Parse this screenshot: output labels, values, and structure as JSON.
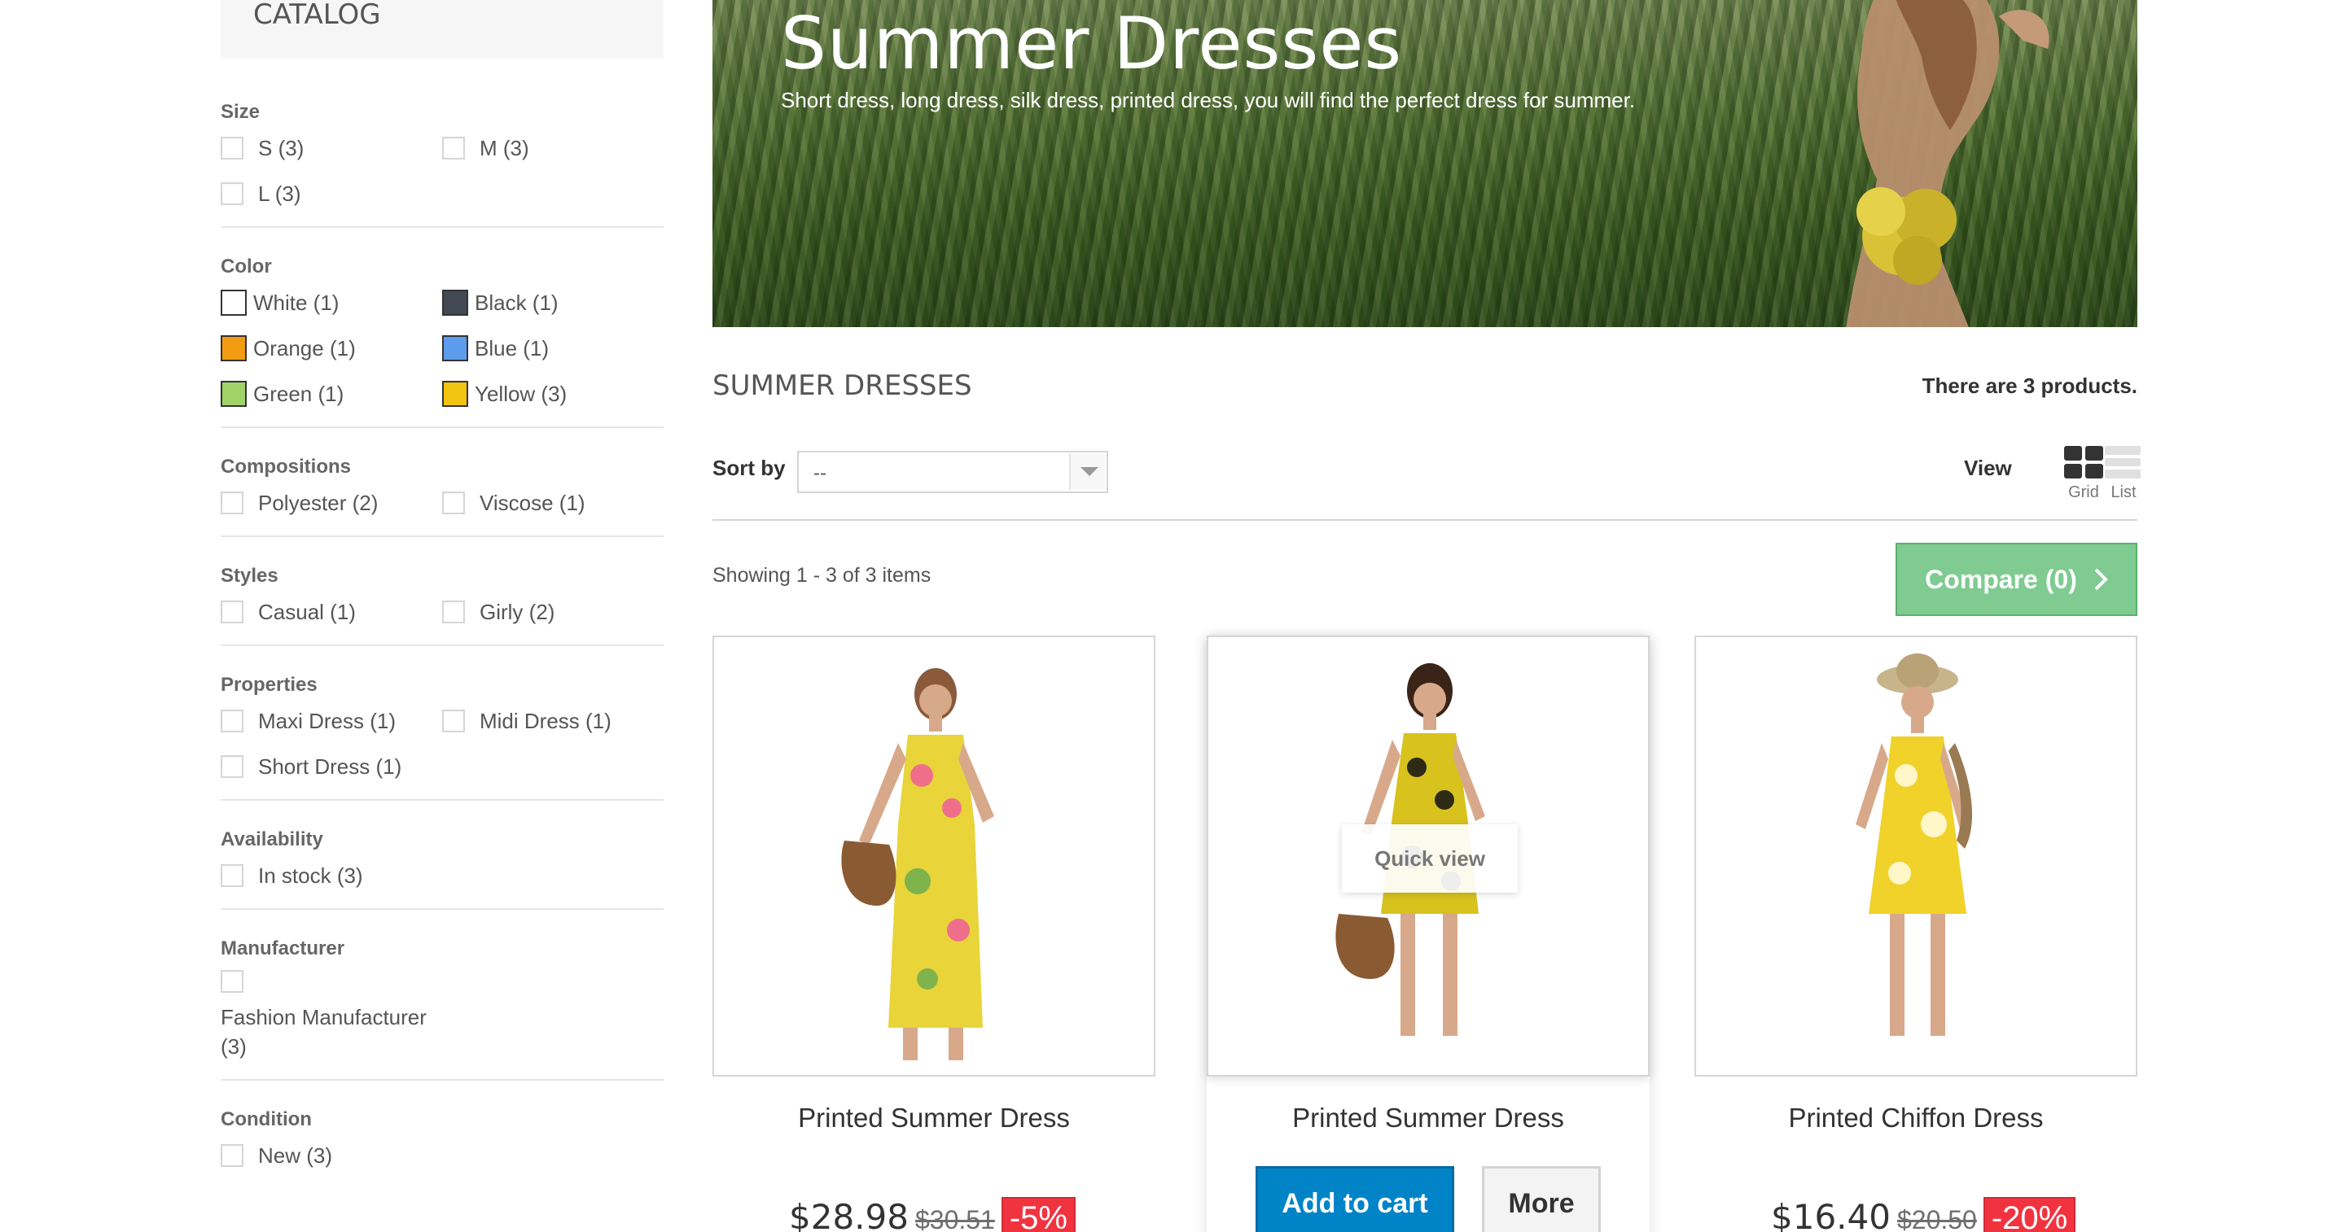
{
  "sidebar": {
    "title": "CATALOG",
    "groups": [
      {
        "title": "Size",
        "options": [
          "S (3)",
          "M (3)",
          "L (3)"
        ]
      },
      {
        "title": "Color",
        "options": [
          {
            "label": "White (1)",
            "color": "#ffffff"
          },
          {
            "label": "Black (1)",
            "color": "#434a54"
          },
          {
            "label": "Orange (1)",
            "color": "#f39c11"
          },
          {
            "label": "Blue (1)",
            "color": "#5d9cec"
          },
          {
            "label": "Green (1)",
            "color": "#a0d468"
          },
          {
            "label": "Yellow (3)",
            "color": "#f1c40f"
          }
        ]
      },
      {
        "title": "Compositions",
        "options": [
          "Polyester (2)",
          "Viscose (1)"
        ]
      },
      {
        "title": "Styles",
        "options": [
          "Casual (1)",
          "Girly (2)"
        ]
      },
      {
        "title": "Properties",
        "options": [
          "Maxi Dress (1)",
          "Midi Dress (1)",
          "Short Dress (1)"
        ]
      },
      {
        "title": "Availability",
        "options": [
          "In stock (3)"
        ]
      },
      {
        "title": "Manufacturer",
        "options": [
          "Fashion Manufacturer (3)"
        ]
      },
      {
        "title": "Condition",
        "options": [
          "New (3)"
        ]
      }
    ]
  },
  "banner": {
    "title": "Summer Dresses",
    "subtitle": "Short dress, long dress, silk dress, printed dress, you will find the perfect dress for summer."
  },
  "category": {
    "name": "SUMMER DRESSES",
    "count_text": "There are 3 products."
  },
  "sort": {
    "label": "Sort by",
    "selected": "--"
  },
  "view": {
    "label": "View",
    "grid_label": "Grid",
    "list_label": "List"
  },
  "showing": "Showing 1 - 3 of 3 items",
  "compare": {
    "label": "Compare (0)",
    "icon": "chevron-right-icon"
  },
  "products": [
    {
      "name": "Printed Summer Dress",
      "price": "$28.98",
      "old_price": "$30.51",
      "reduction": "-5%",
      "dress_color": "#e9d43a"
    },
    {
      "name": "Printed Summer Dress",
      "quick_view": "Quick view",
      "add_to_cart": "Add to cart",
      "more": "More",
      "dress_color": "#d8c21e"
    },
    {
      "name": "Printed Chiffon Dress",
      "price": "$16.40",
      "old_price": "$20.50",
      "reduction": "-20%",
      "dress_color": "#f0d22a"
    }
  ],
  "colors": {
    "accent_blue": "#0084c7",
    "compare_green": "#7fcb91",
    "reduction_red": "#f13340"
  }
}
